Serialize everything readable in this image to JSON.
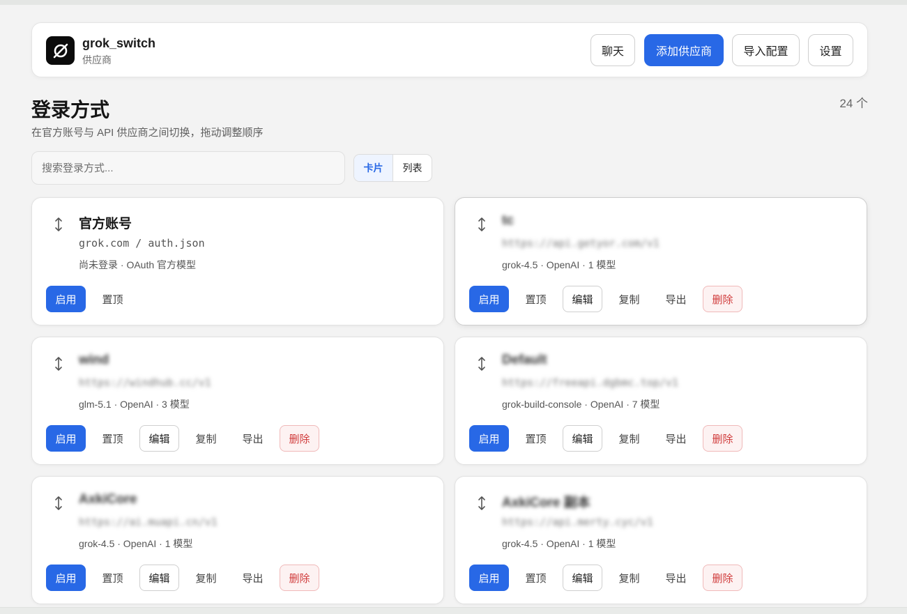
{
  "header": {
    "app_name": "grok_switch",
    "app_subtitle": "供应商",
    "buttons": {
      "chat": "聊天",
      "add_provider": "添加供应商",
      "import_config": "导入配置",
      "settings": "设置"
    }
  },
  "page": {
    "title": "登录方式",
    "description": "在官方账号与 API 供应商之间切换，拖动调整顺序",
    "count": "24 个"
  },
  "search": {
    "placeholder": "搜索登录方式..."
  },
  "view_toggle": {
    "card": "卡片",
    "list": "列表"
  },
  "actions": {
    "enable": "启用",
    "pin": "置顶",
    "edit": "编辑",
    "copy": "复制",
    "export": "导出",
    "delete": "删除"
  },
  "cards": [
    {
      "name": "官方账号",
      "url": "grok.com / auth.json",
      "meta": "尚未登录 · OAuth 官方模型"
    },
    {
      "name": "tc",
      "url": "https://api.getyor.com/v1",
      "meta": "grok-4.5 · OpenAI · 1 模型"
    },
    {
      "name": "wind",
      "url": "https://windhub.cc/v1",
      "meta": "glm-5.1 · OpenAI · 3 模型"
    },
    {
      "name": "Default",
      "url": "https://freeapi.dgbmc.top/v1",
      "meta": "grok-build-console · OpenAI · 7 模型"
    },
    {
      "name": "AxkiCore",
      "url": "https://ai.muapi.cn/v1",
      "meta": "grok-4.5 · OpenAI · 1 模型"
    },
    {
      "name": "AxkiCore 副本",
      "url": "https://api.merty.cyc/v1",
      "meta": "grok-4.5 · OpenAI · 1 模型"
    }
  ],
  "colors": {
    "accent": "#2868e6",
    "danger": "#d03b3b",
    "background": "#f3f3f3"
  }
}
